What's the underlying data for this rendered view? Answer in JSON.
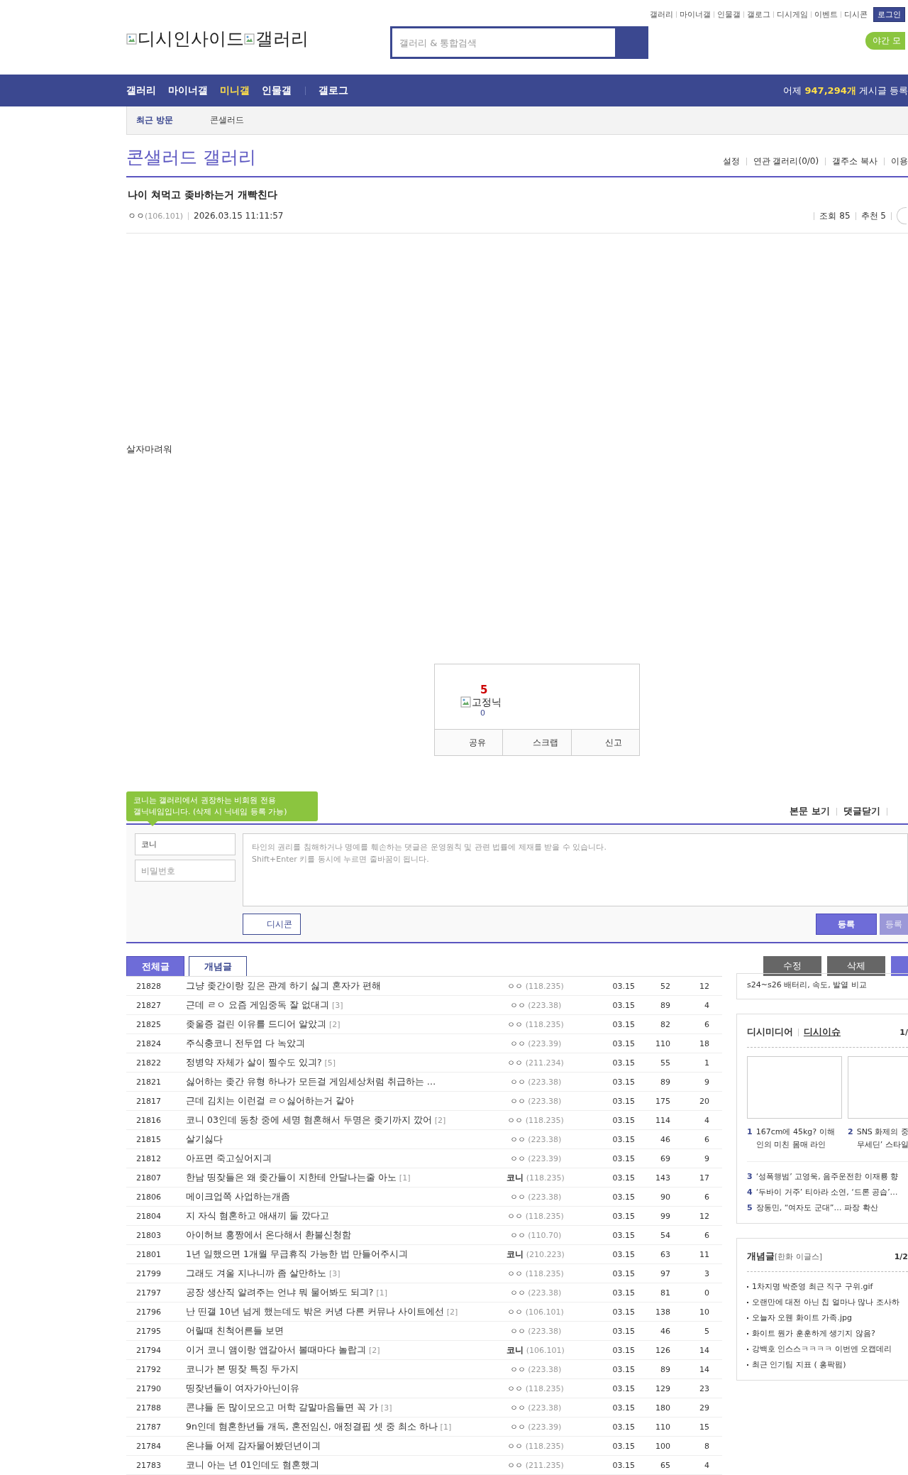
{
  "top_links": [
    "갤러리",
    "마이너갤",
    "인물갤",
    "갤로그",
    "디시게임",
    "이벤트",
    "디시콘"
  ],
  "login_button": "로그인",
  "logo": {
    "site": "디시인사이드",
    "section": "갤러리"
  },
  "search": {
    "placeholder": "갤러리 & 통합검색"
  },
  "night_mode": "야간 모",
  "nav": {
    "items": [
      {
        "label": "갤러리",
        "selected": false
      },
      {
        "label": "마이너갤",
        "selected": false
      },
      {
        "label": "미니갤",
        "selected": true
      },
      {
        "label": "인물갤",
        "selected": false
      },
      {
        "label": "갤로그",
        "selected": false
      }
    ],
    "stat_prefix": "어제",
    "stat_count": "947,294개",
    "stat_suffix": "게시글 등록"
  },
  "recent": {
    "label": "최근 방문",
    "items": [
      "콘샐러드"
    ]
  },
  "gallery": {
    "title": "콘샐러드 갤러리",
    "links": [
      "설정",
      "연관 갤러리(0/0)",
      "갤주소 복사",
      "이용"
    ]
  },
  "post": {
    "title": "나이 쳐먹고 좆바하는거 개빡친다",
    "writer": "ㅇㅇ",
    "ip": "(106.101)",
    "date": "2026.03.15 11:11:57",
    "views": "조회 85",
    "recommends": "추천 5",
    "body": "살자마려워"
  },
  "recommend_box": {
    "up": "5",
    "fixed_nick": "고정닉",
    "fixed_count": "0",
    "actions": [
      "공유",
      "스크랩",
      "신고"
    ]
  },
  "comments": {
    "tooltip_lines": [
      "코니는 갤러리에서 권장하는 비회원 전용",
      "갤닉네임입니다. (삭제 시 닉네임 등록 가능)"
    ],
    "links": [
      "본문 보기",
      "댓글닫기"
    ],
    "nick_value": "코니",
    "password_placeholder": "비밀번호",
    "textarea_placeholder": "타인의 권리를 침해하거나 명예를 훼손하는 댓글은 운영원칙 및 관련 법률에 제재를 받을 수 있습니다.\nShift+Enter 키를 동시에 누르면 줄바꿈이 됩니다.",
    "dccon_button": "디시콘",
    "submit_buttons": [
      {
        "label": "등록",
        "disabled": false
      },
      {
        "label": "등록",
        "disabled": true
      }
    ]
  },
  "list_tabs": [
    {
      "label": "전체글",
      "selected": true
    },
    {
      "label": "개념글",
      "selected": false
    }
  ],
  "list_buttons": [
    {
      "label": "수정",
      "kind": "gray"
    },
    {
      "label": "삭제",
      "kind": "gray"
    },
    {
      "kind": "purple"
    }
  ],
  "rows": [
    {
      "no": "21828",
      "title": "그냥 좆간이랑 깊은 관계 하기 싫긔 혼자가 편해",
      "writer": "ㅇㅇ",
      "ip": "(118.235)",
      "fixed": false,
      "date": "03.15",
      "views": "52",
      "recs": "12"
    },
    {
      "no": "21827",
      "title": "근데 ㄹㅇ 요즘 게임중독 잘 없대긔",
      "replies": "[3]",
      "writer": "ㅇㅇ",
      "ip": "(223.38)",
      "fixed": false,
      "date": "03.15",
      "views": "89",
      "recs": "4"
    },
    {
      "no": "21825",
      "title": "좆울증 걸린 이유를 드디어 알았긔",
      "replies": "[2]",
      "writer": "ㅇㅇ",
      "ip": "(118.235)",
      "fixed": false,
      "date": "03.15",
      "views": "82",
      "recs": "6"
    },
    {
      "no": "21824",
      "title": "주식충코니 전두엽 다 녹았긔",
      "writer": "ㅇㅇ",
      "ip": "(223.39)",
      "fixed": false,
      "date": "03.15",
      "views": "110",
      "recs": "18"
    },
    {
      "no": "21822",
      "title": "정병약 자체가 살이 찔수도 있긔?",
      "replies": "[5]",
      "writer": "ㅇㅇ",
      "ip": "(211.234)",
      "fixed": false,
      "date": "03.15",
      "views": "55",
      "recs": "1"
    },
    {
      "no": "21821",
      "title": "싫어하는 좆간 유형 하나가 모든걸 게임세상처럼 취급하는 …",
      "writer": "ㅇㅇ",
      "ip": "(223.38)",
      "fixed": false,
      "date": "03.15",
      "views": "89",
      "recs": "9"
    },
    {
      "no": "21817",
      "title": "근데 김치는 이런걸 ㄹㅇ싫어하는거 같아",
      "writer": "ㅇㅇ",
      "ip": "(223.38)",
      "fixed": false,
      "date": "03.15",
      "views": "175",
      "recs": "20"
    },
    {
      "no": "21816",
      "title": "코니 03인데 동창 중에 세명 혐혼해서 두명은 좆기까지 깠어",
      "replies": "[2]",
      "writer": "ㅇㅇ",
      "ip": "(118.235)",
      "fixed": false,
      "date": "03.15",
      "views": "114",
      "recs": "4"
    },
    {
      "no": "21815",
      "title": "살기싫다",
      "writer": "ㅇㅇ",
      "ip": "(223.38)",
      "fixed": false,
      "date": "03.15",
      "views": "46",
      "recs": "6"
    },
    {
      "no": "21812",
      "title": "아프면 죽고싶어지긔",
      "writer": "ㅇㅇ",
      "ip": "(223.39)",
      "fixed": false,
      "date": "03.15",
      "views": "69",
      "recs": "9"
    },
    {
      "no": "21807",
      "title": "한남 띵잦들은 왜 좆간들이 지한테 안달나는줄 아노",
      "replies": "[1]",
      "writer": "코니",
      "ip": "(118.235)",
      "fixed": true,
      "date": "03.15",
      "views": "143",
      "recs": "17"
    },
    {
      "no": "21806",
      "title": "메이크업쪽 사업하는개좀",
      "writer": "ㅇㅇ",
      "ip": "(223.38)",
      "fixed": false,
      "date": "03.15",
      "views": "90",
      "recs": "6"
    },
    {
      "no": "21804",
      "title": "지 자식 혐혼하고 애새끼 둘 깠다고",
      "writer": "ㅇㅇ",
      "ip": "(118.235)",
      "fixed": false,
      "date": "03.15",
      "views": "99",
      "recs": "12"
    },
    {
      "no": "21803",
      "title": "아이허브 홍짱에서 온다해서 환불신청함",
      "writer": "ㅇㅇ",
      "ip": "(110.70)",
      "fixed": false,
      "date": "03.15",
      "views": "54",
      "recs": "6"
    },
    {
      "no": "21801",
      "title": "1년 일했으면 1개월 무급휴직 가능한 법 만들어주시긔",
      "writer": "코니",
      "ip": "(210.223)",
      "fixed": true,
      "date": "03.15",
      "views": "63",
      "recs": "11"
    },
    {
      "no": "21799",
      "title": "그래도 겨울 지나니까 좀 살만하노",
      "replies": "[3]",
      "writer": "ㅇㅇ",
      "ip": "(118.235)",
      "fixed": false,
      "date": "03.15",
      "views": "97",
      "recs": "3"
    },
    {
      "no": "21797",
      "title": "공장 생산직 알려주는 언냐 뭐 물어봐도 되긔?",
      "replies": "[1]",
      "writer": "ㅇㅇ",
      "ip": "(223.38)",
      "fixed": false,
      "date": "03.15",
      "views": "81",
      "recs": "0"
    },
    {
      "no": "21796",
      "title": "난 띤갤 10년 넘게 했는데도 밖은 커녕 다른 커뮤나 사이트에선",
      "replies": "[2]",
      "writer": "ㅇㅇ",
      "ip": "(106.101)",
      "fixed": false,
      "date": "03.15",
      "views": "138",
      "recs": "10"
    },
    {
      "no": "21795",
      "title": "어릴때 친척어른들 보면",
      "writer": "ㅇㅇ",
      "ip": "(223.38)",
      "fixed": false,
      "date": "03.15",
      "views": "46",
      "recs": "5"
    },
    {
      "no": "21794",
      "title": "이거 코니 앰이랑 앱갈아서 볼때마다 놀랍긔",
      "replies": "[2]",
      "writer": "코니",
      "ip": "(106.101)",
      "fixed": true,
      "date": "03.15",
      "views": "126",
      "recs": "14"
    },
    {
      "no": "21792",
      "title": "코니가 본 띵잦 특징 두가지",
      "writer": "ㅇㅇ",
      "ip": "(223.38)",
      "fixed": false,
      "date": "03.15",
      "views": "89",
      "recs": "14"
    },
    {
      "no": "21790",
      "title": "띵잦년들이 여자가아닌이유",
      "writer": "ㅇㅇ",
      "ip": "(118.235)",
      "fixed": false,
      "date": "03.15",
      "views": "129",
      "recs": "23"
    },
    {
      "no": "21788",
      "title": "콘냐들 돈 많이모으고 머학 갈말마음들면 꼭 가",
      "replies": "[3]",
      "writer": "ㅇㅇ",
      "ip": "(223.38)",
      "fixed": false,
      "date": "03.15",
      "views": "180",
      "recs": "29"
    },
    {
      "no": "21787",
      "title": "9n인데 혐혼한년들 개독, 혼전임신, 애정결핍 셋 중 최소 하나",
      "replies": "[1]",
      "writer": "ㅇㅇ",
      "ip": "(223.39)",
      "fixed": false,
      "date": "03.15",
      "views": "110",
      "recs": "15"
    },
    {
      "no": "21784",
      "title": "온냐들 어제 감자물어봤던년이긔",
      "writer": "ㅇㅇ",
      "ip": "(118.235)",
      "fixed": false,
      "date": "03.15",
      "views": "100",
      "recs": "8"
    },
    {
      "no": "21783",
      "title": "코니 아는 년 01인데도 혐혼했긔",
      "writer": "ㅇㅇ",
      "ip": "(211.235)",
      "fixed": false,
      "date": "03.15",
      "views": "65",
      "recs": "4"
    }
  ],
  "sidebar": {
    "top_box": "s24~s26 배터리, 속도, 발열 비교",
    "media": {
      "tabs": [
        {
          "label": "디시미디어",
          "selected": false
        },
        {
          "label": "디시이슈",
          "selected": true
        }
      ],
      "page": "1/",
      "cards": [
        {
          "rank": "1",
          "lines": [
            "167cm에 45kg? 이해",
            "인의 미친 몸매 라인"
          ]
        },
        {
          "rank": "2",
          "lines": [
            "SNS 화제의 중",
            "무세딘’ 스타일"
          ]
        }
      ],
      "items": [
        {
          "rank": "3",
          "text": "‘성폭행범’ 고영욱, 음주운전한 이재룡 향"
        },
        {
          "rank": "4",
          "text": "‘두바이 거주’ 티아라 소연, ‘드론 공습’…"
        },
        {
          "rank": "5",
          "text": "장동민, “여자도 군대”… 파장 확산"
        }
      ]
    },
    "concept": {
      "title": "개념글",
      "team": "[한화 이글스]",
      "page": "1/2",
      "items": [
        "1차지명 박준영 최근 직구 구위.gif",
        "오랜만에 대전 아닌 칩 얼마나 많나 조사하",
        "오늘자 오웬 화이트 가족.jpg",
        "화이트 뭔가 훈훈하게 생기지 않음?",
        "강백호 인스스ㅋㅋㅋㅋ 이번엔 오캡데리",
        "최근 인기팀 지표 ( 홍팍펌)"
      ]
    }
  }
}
